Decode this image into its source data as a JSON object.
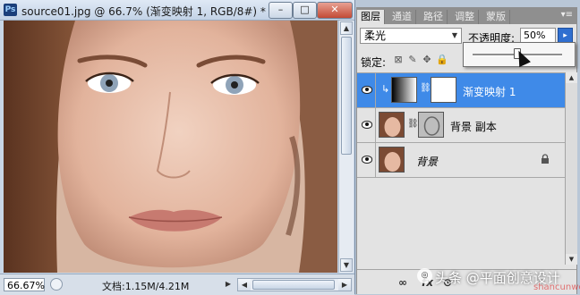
{
  "document": {
    "app_icon": "Ps",
    "title": "source01.jpg @ 66.7% (渐变映射 1, RGB/8#) *",
    "buttons": {
      "minimize": "–",
      "maximize": "□",
      "close": "✕"
    },
    "zoom": "66.67%",
    "doc_info": "文档:1.15M/4.21M"
  },
  "panel": {
    "tabs": [
      {
        "label": "图层",
        "active": true
      },
      {
        "label": "通道",
        "active": false
      },
      {
        "label": "路径",
        "active": false
      },
      {
        "label": "调整",
        "active": false
      },
      {
        "label": "蒙版",
        "active": false
      }
    ],
    "menu": "▾≡",
    "blend_mode": "柔光",
    "opacity_label": "不透明度:",
    "opacity_value": "50%",
    "opacity_slider_fraction": 0.5,
    "lock_label": "锁定:",
    "layers": [
      {
        "name": "渐变映射 1",
        "selected": true,
        "type": "adjustment",
        "locked": false
      },
      {
        "name": "背景 副本",
        "selected": false,
        "type": "masked-photo",
        "locked": false
      },
      {
        "name": "背景",
        "selected": false,
        "type": "photo",
        "locked": true
      }
    ],
    "bottom_icons": [
      "fx",
      "⊙"
    ]
  },
  "watermark": {
    "text": "头条 @平面创意设计",
    "corner_text": "shancunwei"
  },
  "colors": {
    "selection": "#3f8ae8",
    "panel_bg": "#e3e3e3",
    "tab_strip": "#8f8f8f",
    "window_chrome": "#c8d6e6"
  }
}
